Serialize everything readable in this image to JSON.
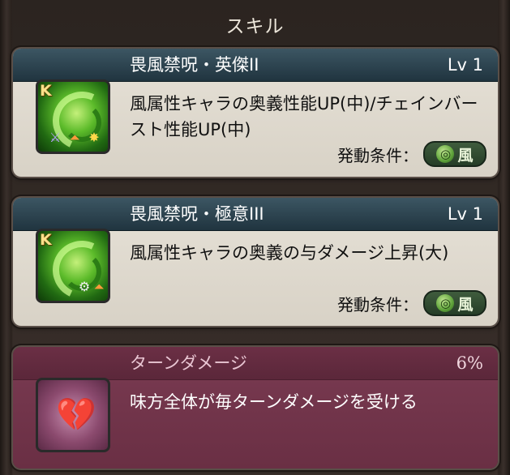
{
  "section": {
    "title": "スキル"
  },
  "skills": [
    {
      "name": "畏風禁呪・英傑II",
      "level": "Lv 1",
      "description": "風属性キャラの奥義性能UP(中)/チェインバースト性能UP(中)",
      "condition_label": "発動条件：",
      "condition_element": "風",
      "icon": "wind-spell-icon",
      "badge": "K"
    },
    {
      "name": "畏風禁呪・極意III",
      "level": "Lv 1",
      "description": "風属性キャラの奥義の与ダメージ上昇(大)",
      "condition_label": "発動条件：",
      "condition_element": "風",
      "icon": "wind-spell-icon",
      "badge": "K"
    }
  ],
  "debuff": {
    "name": "ターンダメージ",
    "value": "6%",
    "description": "味方全体が毎ターンダメージを受ける",
    "icon": "broken-heart-icon"
  },
  "colors": {
    "skill_header": "#2c4451",
    "skill_body": "#e2ddd3",
    "debuff_body": "#723548",
    "wind_green": "#5cbb2a"
  }
}
